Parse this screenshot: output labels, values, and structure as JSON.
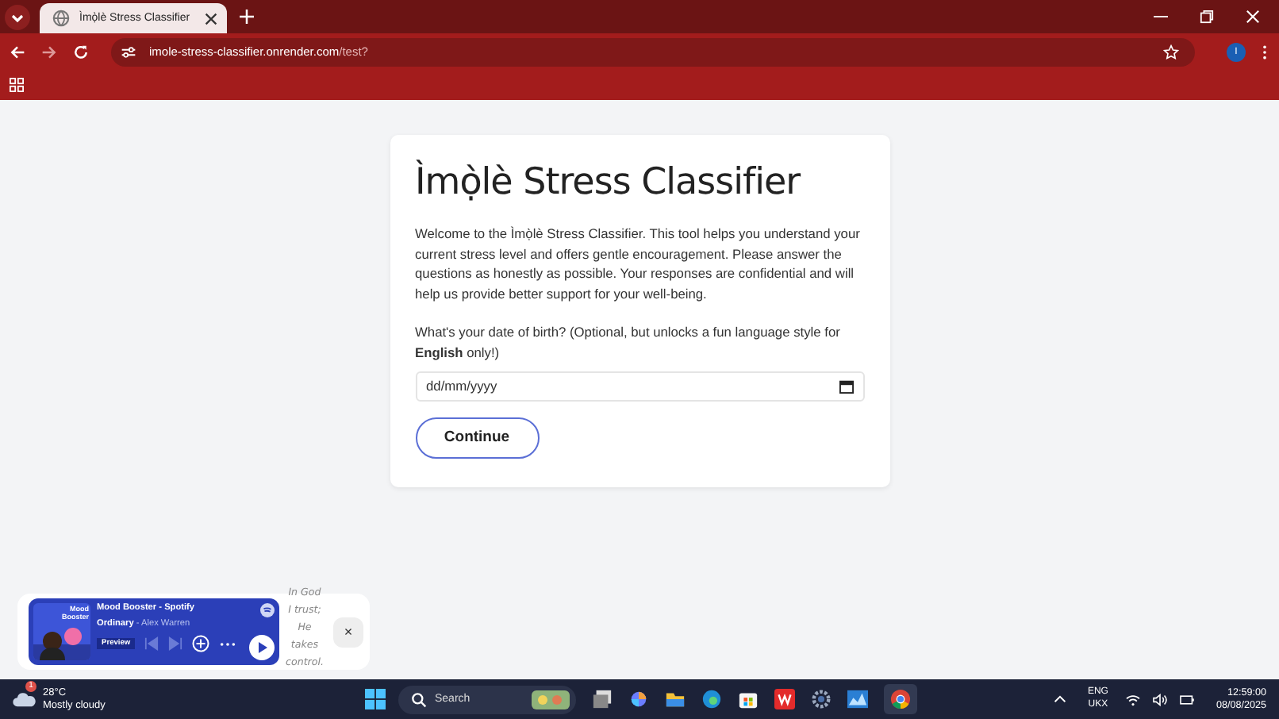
{
  "browser": {
    "tab_title": "Ìmọ̀lè Stress Classifier",
    "url_host": "imole-stress-classifier.onrender.com",
    "url_path": "/test?",
    "profile_initial": "I"
  },
  "page": {
    "title": "Ìmọ̀lè Stress Classifier",
    "intro": "Welcome to the Ìmọ̀lè Stress Classifier. This tool helps you understand your current stress level and offers gentle encouragement. Please answer the questions as honestly as possible. Your responses are confidential and will help us provide better support for your well-being.",
    "dob_label": "What's your date of birth? (Optional, but unlocks a fun language style for **English** only!)",
    "date_placeholder": "dd/mm/yyyy",
    "button": "Continue"
  },
  "widget": {
    "art_label": "Mood Booster",
    "title": "Mood Booster - Spotify",
    "track": "Ordinary",
    "artist": "- Alex Warren",
    "badge": "Preview",
    "quote": "In God I trust; He takes control.",
    "close": "×"
  },
  "taskbar": {
    "temperature": "28°C",
    "condition": "Mostly cloudy",
    "alert_count": "1",
    "search": "Search",
    "language": "ENG",
    "region": "UKX",
    "time": "12:59:00",
    "date": "08/08/2025"
  }
}
